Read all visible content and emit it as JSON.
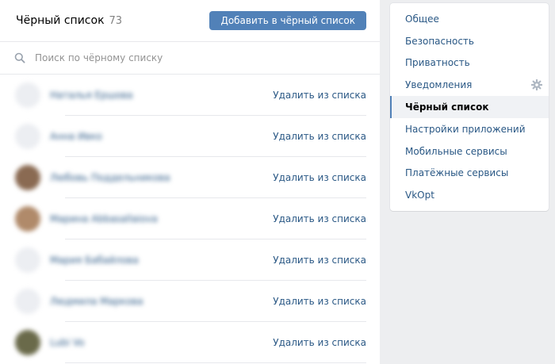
{
  "header": {
    "title": "Чёрный список",
    "count": "73",
    "add_button_label": "Добавить в чёрный список"
  },
  "search": {
    "placeholder": "Поиск по чёрному списку",
    "value": ""
  },
  "list": {
    "remove_label": "Удалить из списка",
    "items": [
      {
        "name": "Наталья Ершова",
        "avatar_color": "#eceef2"
      },
      {
        "name": "Анна Ивко",
        "avatar_color": "#eceef2"
      },
      {
        "name": "Любовь Поддельникова",
        "avatar_color": "#8a6a52"
      },
      {
        "name": "Марина Abbasallaiova",
        "avatar_color": "#b08a6a"
      },
      {
        "name": "Мария Бабайлова",
        "avatar_color": "#eceef2"
      },
      {
        "name": "Людмила Маркова",
        "avatar_color": "#eceef2"
      },
      {
        "name": "Lubi Vo",
        "avatar_color": "#6a6a4a"
      }
    ]
  },
  "menu": {
    "items": [
      {
        "label": "Общее",
        "active": false
      },
      {
        "label": "Безопасность",
        "active": false
      },
      {
        "label": "Приватность",
        "active": false
      },
      {
        "label": "Уведомления",
        "active": false,
        "icon": "gear-icon"
      },
      {
        "label": "Чёрный список",
        "active": true
      },
      {
        "label": "Настройки приложений",
        "active": false
      },
      {
        "label": "Мобильные сервисы",
        "active": false
      },
      {
        "label": "Платёжные сервисы",
        "active": false
      },
      {
        "label": "VkOpt",
        "active": false
      }
    ]
  },
  "colors": {
    "accent": "#5181b8",
    "link": "#2a5885",
    "background": "#edeef0"
  }
}
